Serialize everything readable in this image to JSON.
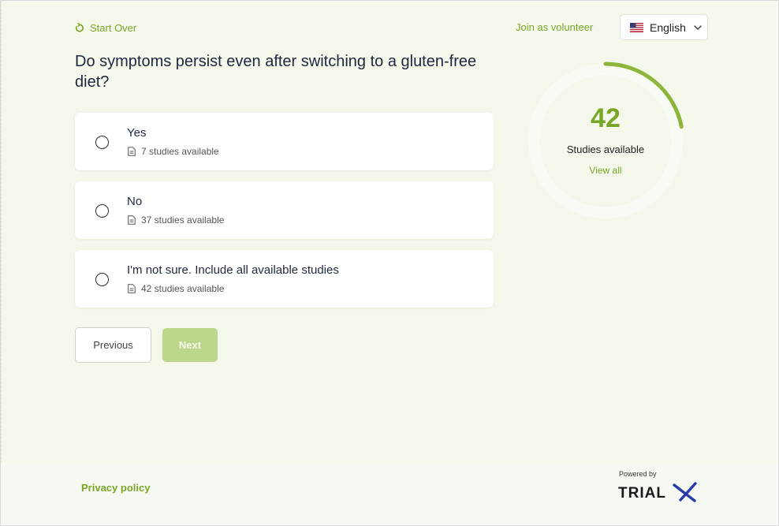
{
  "header": {
    "start_over": "Start Over",
    "join_volunteer": "Join as volunteer",
    "language": "English"
  },
  "question": "Do symptoms persist even after switching to a gluten-free diet?",
  "options": [
    {
      "label": "Yes",
      "meta": "7 studies available"
    },
    {
      "label": "No",
      "meta": "37 studies available"
    },
    {
      "label": "I'm not sure. Include all available studies",
      "meta": "42 studies available"
    }
  ],
  "buttons": {
    "previous": "Previous",
    "next": "Next"
  },
  "summary": {
    "count": "42",
    "label": "Studies available",
    "view_all": "View all",
    "progress_fraction": 0.22
  },
  "footer": {
    "privacy": "Privacy policy",
    "powered_by": "Powered by",
    "logo_text": "TRIALX"
  },
  "colors": {
    "accent": "#7aa628",
    "background": "#f3f8ea",
    "next_disabled": "#bcd68c"
  },
  "icons": [
    "refresh-icon",
    "us-flag-icon",
    "chevron-down-icon",
    "document-icon"
  ]
}
